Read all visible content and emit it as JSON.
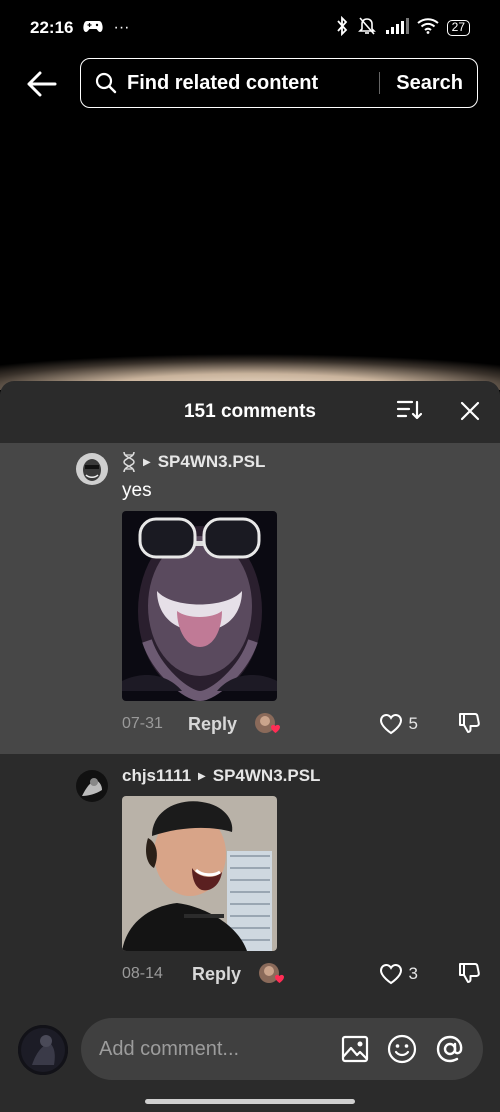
{
  "status_bar": {
    "time": "22:16",
    "dots": "···",
    "battery": "27"
  },
  "header": {
    "search_placeholder": "Find related content",
    "search_button": "Search"
  },
  "comments_panel": {
    "title": "151 comments",
    "comments": [
      {
        "reply_to": "SP4WN3.PSL",
        "text": "yes",
        "date": "07-31",
        "reply_label": "Reply",
        "likes": "5"
      },
      {
        "username": "chjs1111",
        "reply_to": "SP4WN3.PSL",
        "date": "08-14",
        "reply_label": "Reply",
        "likes": "3"
      }
    ]
  },
  "input": {
    "placeholder": "Add comment..."
  },
  "icons": {
    "back": "arrow-left-icon",
    "search": "search-icon",
    "sort": "sort-icon",
    "close": "close-icon",
    "like": "heart-outline-icon",
    "dislike": "thumbs-down-icon",
    "image": "image-icon",
    "emoji": "emoji-icon",
    "mention": "at-icon"
  },
  "colors": {
    "background": "#000000",
    "sheet": "#2b2b2b",
    "highlight_row": "#474747",
    "input": "#404040",
    "muted_text": "#9a9a9a",
    "heart_badge": "#ff2d55"
  }
}
